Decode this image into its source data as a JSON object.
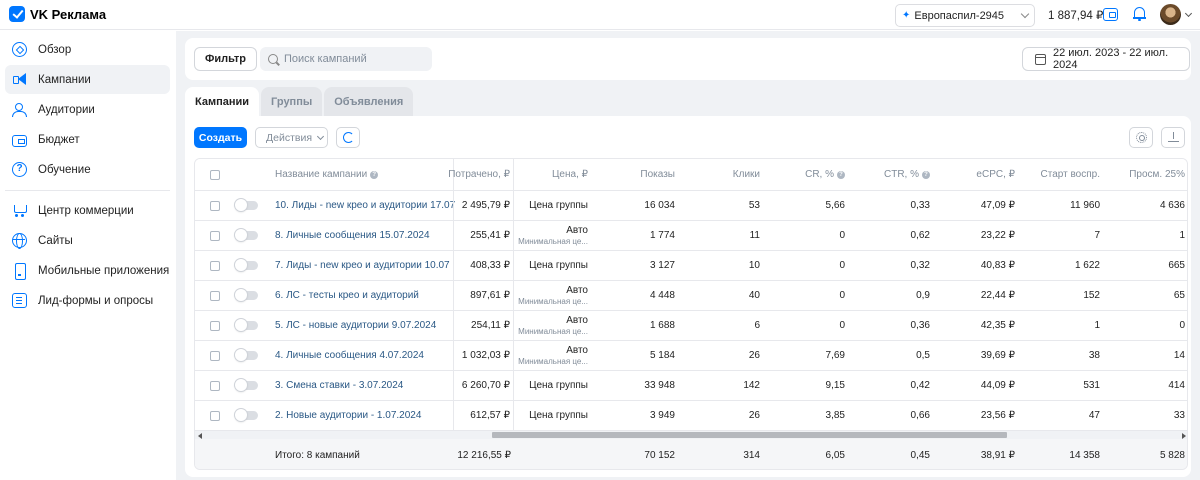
{
  "app": {
    "logo_text": "VK Реклама"
  },
  "topbar": {
    "account": "Европаспил-2945",
    "balance": "1 887,94 ₽",
    "icons": [
      "vk-logo-icon",
      "wallet-icon",
      "bell-icon",
      "avatar",
      "chevron-down-icon"
    ]
  },
  "sidebar": {
    "items": [
      {
        "label": "Обзор",
        "icon": "compass-icon"
      },
      {
        "label": "Кампании",
        "icon": "megaphone-icon"
      },
      {
        "label": "Аудитории",
        "icon": "people-icon"
      },
      {
        "label": "Бюджет",
        "icon": "wallet-icon"
      },
      {
        "label": "Обучение",
        "icon": "help-icon"
      },
      {
        "label": "Центр коммерции",
        "icon": "cart-icon"
      },
      {
        "label": "Сайты",
        "icon": "globe-icon"
      },
      {
        "label": "Мобильные приложения",
        "icon": "phone-icon"
      },
      {
        "label": "Лид-формы и опросы",
        "icon": "form-icon"
      }
    ],
    "active": "Кампании"
  },
  "filter_bar": {
    "filter_label": "Фильтр",
    "search_placeholder": "Поиск кампаний",
    "date_range": "22 июл. 2023 - 22 июл. 2024"
  },
  "tabs": [
    {
      "label": "Кампании",
      "active": true
    },
    {
      "label": "Группы",
      "active": false
    },
    {
      "label": "Объявления",
      "active": false
    }
  ],
  "toolbar": {
    "create_label": "Создать",
    "actions_label": "Действия"
  },
  "table": {
    "headers": {
      "name": "Название кампании",
      "spent": "Потрачено, ₽",
      "price": "Цена, ₽",
      "shows": "Показы",
      "clicks": "Клики",
      "cr": "CR, %",
      "ctr": "CTR, %",
      "ecpc": "eCPC, ₽",
      "start": "Старт воспр.",
      "views": "Просм. 25%"
    },
    "price_sub": "Минимальная це...",
    "rows": [
      {
        "name": "10. Лиды - new крео и аудитории 17.07",
        "spent": "2 495,79 ₽",
        "price": "Цена группы",
        "price_auto": false,
        "shows": "16 034",
        "clicks": "53",
        "cr": "5,66",
        "ctr": "0,33",
        "ecpc": "47,09 ₽",
        "start": "11 960",
        "views": "4 636"
      },
      {
        "name": "8. Личные сообщения 15.07.2024",
        "spent": "255,41 ₽",
        "price": "Авто",
        "price_auto": true,
        "shows": "1 774",
        "clicks": "11",
        "cr": "0",
        "ctr": "0,62",
        "ecpc": "23,22 ₽",
        "start": "7",
        "views": "1"
      },
      {
        "name": "7. Лиды - new крео и аудитории 10.07",
        "spent": "408,33 ₽",
        "price": "Цена группы",
        "price_auto": false,
        "shows": "3 127",
        "clicks": "10",
        "cr": "0",
        "ctr": "0,32",
        "ecpc": "40,83 ₽",
        "start": "1 622",
        "views": "665"
      },
      {
        "name": "6. ЛС - тесты крео и аудиторий",
        "spent": "897,61 ₽",
        "price": "Авто",
        "price_auto": true,
        "shows": "4 448",
        "clicks": "40",
        "cr": "0",
        "ctr": "0,9",
        "ecpc": "22,44 ₽",
        "start": "152",
        "views": "65"
      },
      {
        "name": "5. ЛС - новые аудитории 9.07.2024",
        "spent": "254,11 ₽",
        "price": "Авто",
        "price_auto": true,
        "shows": "1 688",
        "clicks": "6",
        "cr": "0",
        "ctr": "0,36",
        "ecpc": "42,35 ₽",
        "start": "1",
        "views": "0"
      },
      {
        "name": "4. Личные сообщения 4.07.2024",
        "spent": "1 032,03 ₽",
        "price": "Авто",
        "price_auto": true,
        "shows": "5 184",
        "clicks": "26",
        "cr": "7,69",
        "ctr": "0,5",
        "ecpc": "39,69 ₽",
        "start": "38",
        "views": "14"
      },
      {
        "name": "3. Смена ставки - 3.07.2024",
        "spent": "6 260,70 ₽",
        "price": "Цена группы",
        "price_auto": false,
        "shows": "33 948",
        "clicks": "142",
        "cr": "9,15",
        "ctr": "0,42",
        "ecpc": "44,09 ₽",
        "start": "531",
        "views": "414"
      },
      {
        "name": "2. Новые аудитории - 1.07.2024",
        "spent": "612,57 ₽",
        "price": "Цена группы",
        "price_auto": false,
        "shows": "3 949",
        "clicks": "26",
        "cr": "3,85",
        "ctr": "0,66",
        "ecpc": "23,56 ₽",
        "start": "47",
        "views": "33"
      }
    ],
    "total": {
      "label": "Итого: 8 кампаний",
      "spent": "12 216,55 ₽",
      "shows": "70 152",
      "clicks": "314",
      "cr": "6,05",
      "ctr": "0,45",
      "ecpc": "38,91 ₽",
      "start": "14 358",
      "views": "5 828"
    }
  }
}
